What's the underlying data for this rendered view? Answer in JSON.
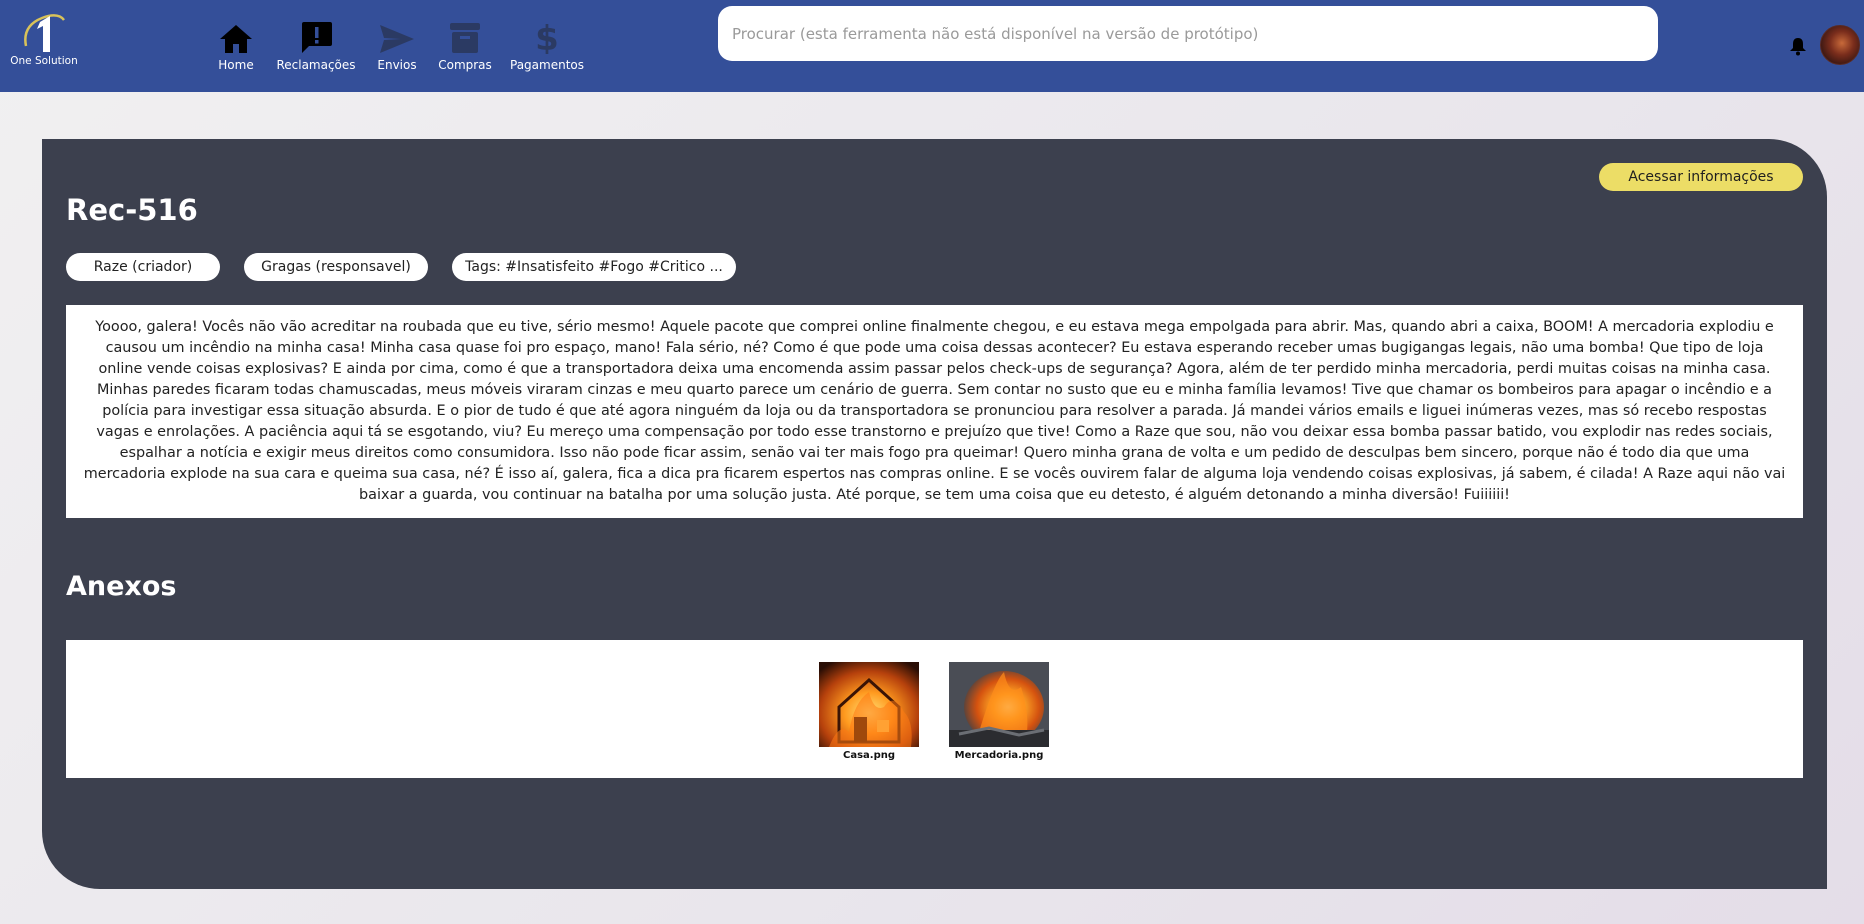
{
  "header": {
    "logo_text": "One Solution",
    "nav": [
      {
        "label": "Home",
        "icon": "home-icon"
      },
      {
        "label": "Reclamações",
        "icon": "complaint-icon"
      },
      {
        "label": "Envios",
        "icon": "send-icon"
      },
      {
        "label": "Compras",
        "icon": "archive-icon"
      },
      {
        "label": "Pagamentos",
        "icon": "dollar-icon"
      }
    ],
    "search_placeholder": "Procurar (esta ferramenta não está disponível na versão de protótipo)",
    "notification_icon": "bell-icon",
    "avatar_icon": "user-avatar"
  },
  "complaint": {
    "access_button": "Acessar informações",
    "title": "Rec-516",
    "chips": [
      "Raze (criador)",
      "Gragas (responsavel)",
      "Tags: #Insatisfeito #Fogo #Critico ..."
    ],
    "description": "Yoooo, galera! Vocês não vão acreditar na roubada que eu tive, sério mesmo! Aquele pacote que comprei online finalmente chegou, e eu estava mega empolgada para abrir. Mas, quando abri a caixa, BOOM! A mercadoria explodiu e causou um incêndio na minha casa! Minha casa quase foi pro espaço, mano! Fala sério, né? Como é que pode uma coisa dessas acontecer? Eu estava esperando receber umas bugigangas legais, não uma bomba! Que tipo de loja online vende coisas explosivas? E ainda por cima, como é que a transportadora deixa uma encomenda assim passar pelos check-ups de segurança? Agora, além de ter perdido minha mercadoria, perdi muitas coisas na minha casa. Minhas paredes ficaram todas chamuscadas, meus móveis viraram cinzas e meu quarto parece um cenário de guerra. Sem contar no susto que eu e minha família levamos! Tive que chamar os bombeiros para apagar o incêndio e a polícia para investigar essa situação absurda. E o pior de tudo é que até agora ninguém da loja ou da transportadora se pronunciou para resolver a parada. Já mandei vários emails e liguei inúmeras vezes, mas só recebo respostas vagas e enrolações. A paciência aqui tá se esgotando, viu? Eu mereço uma compensação por todo esse transtorno e prejuízo que tive! Como a Raze que sou, não vou deixar essa bomba passar batido, vou explodir nas redes sociais, espalhar a notícia e exigir meus direitos como consumidora. Isso não pode ficar assim, senão vai ter mais fogo pra queimar! Quero minha grana de volta e um pedido de desculpas bem sincero, porque não é todo dia que uma mercadoria explode na sua cara e queima sua casa, né? É isso aí, galera, fica a dica pra ficarem espertos nas compras online. E se vocês ouvirem falar de alguma loja vendendo coisas explosivas, já sabem, é cilada! A Raze aqui não vai baixar a guarda, vou continuar na batalha por uma solução justa. Até porque, se tem uma coisa que eu detesto, é alguém detonando a minha diversão! Fuiiiiii!",
    "attachments_title": "Anexos",
    "attachments": [
      {
        "name": "Casa.png",
        "icon": "burning-house-thumbnail"
      },
      {
        "name": "Mercadoria.png",
        "icon": "burning-merchandise-thumbnail"
      }
    ]
  },
  "colors": {
    "header_bg": "#344f99",
    "card_bg": "#3c404e",
    "accent_button": "#ecdd66"
  }
}
